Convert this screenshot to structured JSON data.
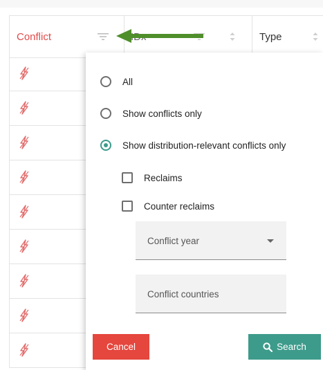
{
  "table": {
    "columns": [
      {
        "label": "Conflict",
        "color": "#e04b4b"
      },
      {
        "label": "IDx"
      },
      {
        "label": "Type"
      }
    ],
    "row_icon": "bolt-icon",
    "row_count": 9
  },
  "filter_popup": {
    "options": [
      {
        "label": "All",
        "selected": false
      },
      {
        "label": "Show conflicts only",
        "selected": false
      },
      {
        "label": "Show distribution-relevant conflicts only",
        "selected": true
      }
    ],
    "checkboxes": [
      {
        "label": "Reclaims",
        "checked": false
      },
      {
        "label": "Counter reclaims",
        "checked": false
      }
    ],
    "conflict_year_label": "Conflict year",
    "conflict_countries_label": "Conflict countries",
    "cancel_label": "Cancel",
    "search_label": "Search"
  },
  "colors": {
    "accent": "#3d9b8b",
    "danger": "#e5463d",
    "annotation_arrow": "#4f8f2b"
  }
}
